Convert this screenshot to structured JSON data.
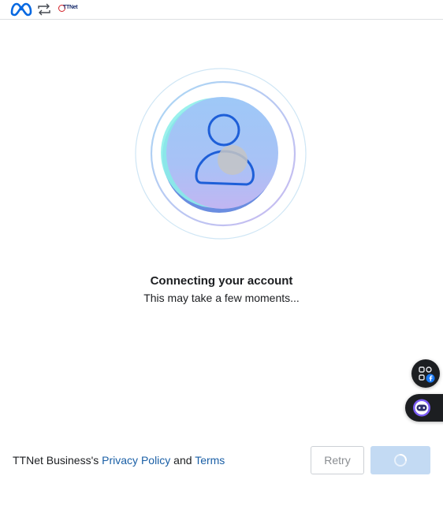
{
  "header": {
    "logo_icon": "meta-logo-icon",
    "connect_icon": "two-way-arrows-icon",
    "partner_logo_text": "TTNet"
  },
  "main": {
    "illustration_icon": "user-avatar-icon",
    "status_title": "Connecting your account",
    "status_subtitle": "This may take a few moments..."
  },
  "footer": {
    "legal_prefix": "TTNet Business's ",
    "privacy_link": "Privacy Policy",
    "legal_and": " and ",
    "terms_link": "Terms",
    "retry_label": "Retry",
    "primary_icon": "loading-spinner-icon"
  },
  "floating": {
    "apps_icon": "apps-grid-facebook-icon",
    "assistant_icon": "assistant-bot-icon"
  },
  "colors": {
    "link": "#1a5fa6",
    "primary_disabled": "#c3daf3",
    "meta_blue": "#0668e1"
  }
}
